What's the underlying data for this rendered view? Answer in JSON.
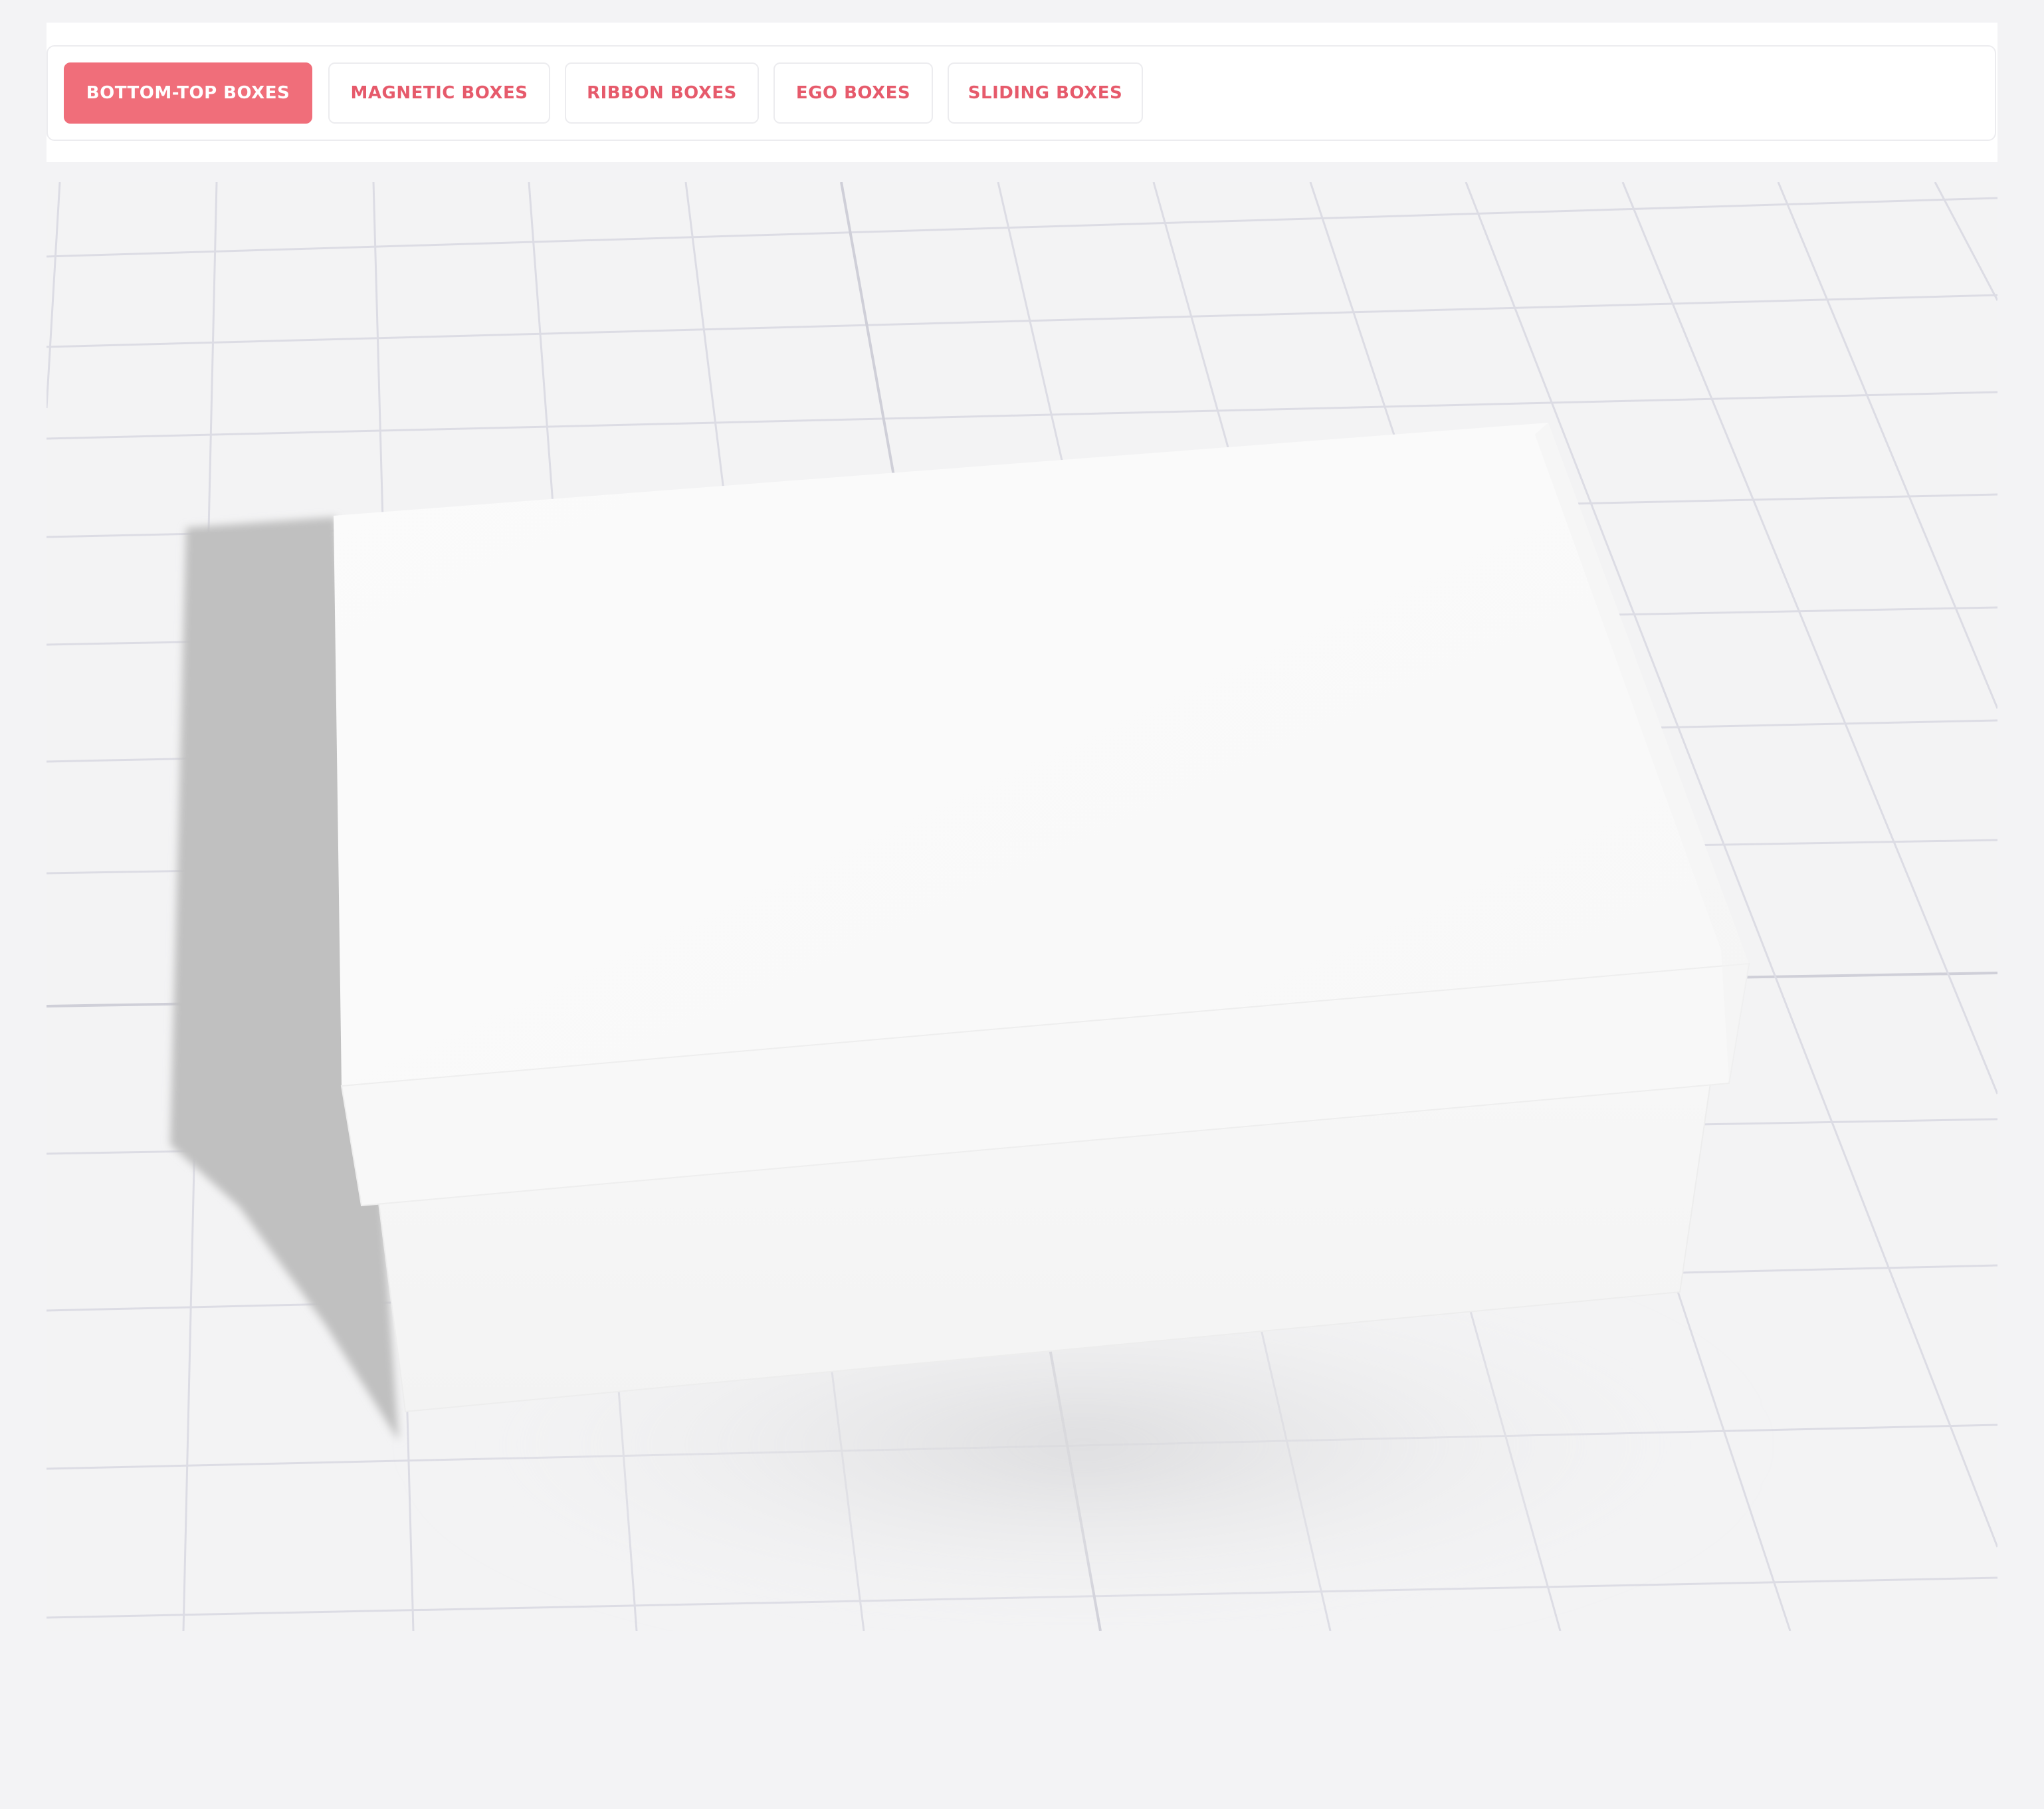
{
  "tabs": [
    {
      "label": "BOTTOM-TOP BOXES",
      "active": true
    },
    {
      "label": "MAGNETIC BOXES",
      "active": false
    },
    {
      "label": "RIBBON BOXES",
      "active": false
    },
    {
      "label": "EGO BOXES",
      "active": false
    },
    {
      "label": "SLIDING BOXES",
      "active": false
    }
  ],
  "colors": {
    "accent": "#f06e7a",
    "accent_text": "#e65a6b",
    "page_background": "#f3f3f5",
    "floor_grid": "#dcdce4",
    "box_white": "#fafafa"
  },
  "viewer": {
    "object": "bottom-top-box-3d-model"
  }
}
